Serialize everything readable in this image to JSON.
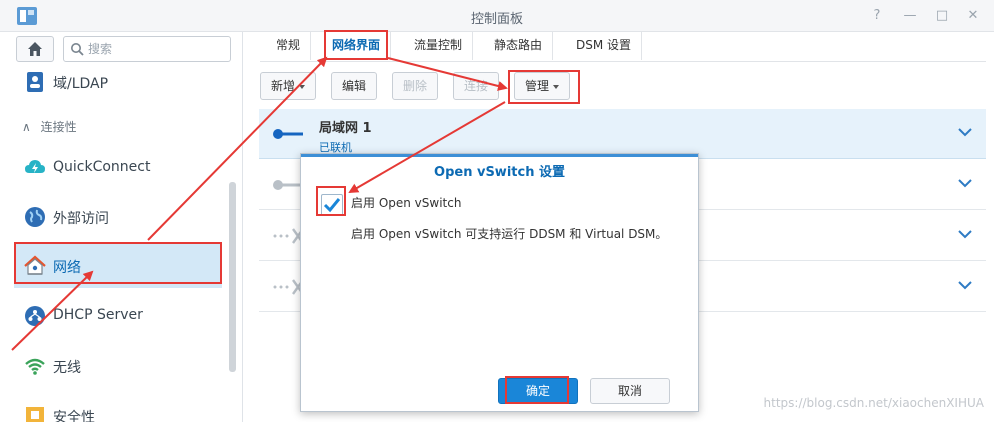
{
  "window": {
    "title": "控制面板"
  },
  "sidebar": {
    "search_placeholder": "搜索",
    "items_top": [
      {
        "label": "域/LDAP",
        "icon": "domain-ldap-icon"
      }
    ],
    "section_label": "连接性",
    "items": [
      {
        "label": "QuickConnect",
        "icon": "quickconnect-cloud-icon"
      },
      {
        "label": "外部访问",
        "icon": "globe-icon"
      },
      {
        "label": "网络",
        "icon": "house-network-icon",
        "active": true
      },
      {
        "label": "DHCP Server",
        "icon": "dhcp-server-icon"
      },
      {
        "label": "无线",
        "icon": "wifi-icon"
      },
      {
        "label": "安全性",
        "icon": "shield-icon"
      }
    ]
  },
  "tabs": [
    {
      "label": "常规"
    },
    {
      "label": "网络界面",
      "active": true
    },
    {
      "label": "流量控制"
    },
    {
      "label": "静态路由"
    },
    {
      "label": "DSM 设置"
    }
  ],
  "toolbar": {
    "create": "新增",
    "edit": "编辑",
    "delete": "删除",
    "connect": "连接",
    "manage": "管理"
  },
  "interfaces": [
    {
      "title": "局域网 1",
      "status": "已联机"
    }
  ],
  "dialog": {
    "title": "Open vSwitch 设置",
    "checkbox_label": "启用 Open vSwitch",
    "checked": true,
    "description": "启用 Open vSwitch 可支持运行 DDSM 和 Virtual DSM。",
    "ok": "确定",
    "cancel": "取消"
  },
  "watermark": "https://blog.csdn.net/xiaochenXIHUA",
  "colors": {
    "accent": "#0c6ab3",
    "highlight": "#e53935",
    "primary_button": "#1a86d8"
  }
}
